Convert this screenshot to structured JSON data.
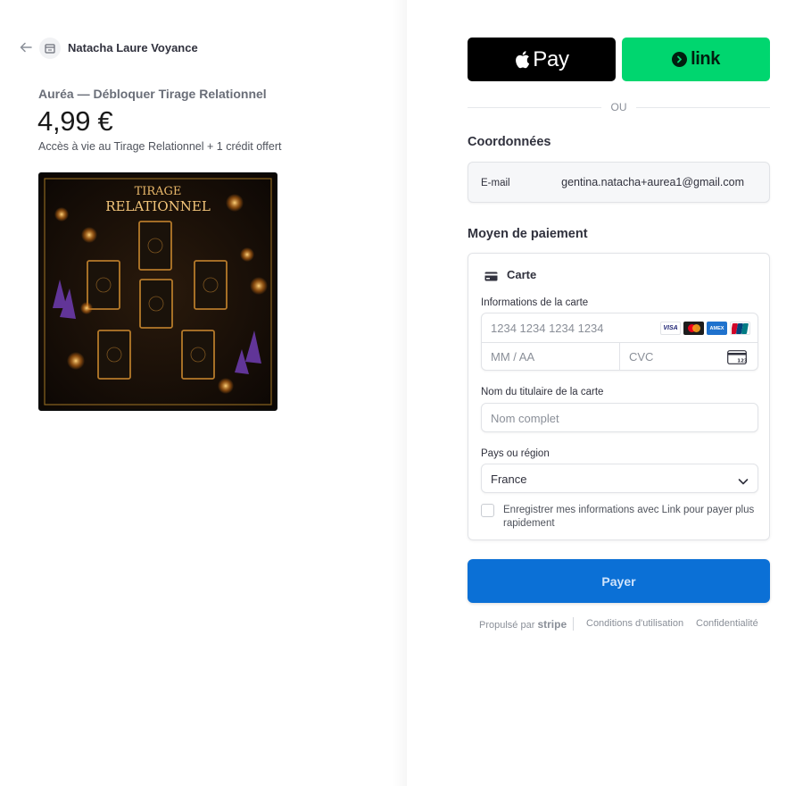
{
  "header": {
    "merchant_name": "Natacha Laure Voyance",
    "back_icon": "arrow-left-icon",
    "store_icon": "store-icon"
  },
  "product": {
    "name": "Auréa — Débloquer Tirage Relationnel",
    "price": "4,99 €",
    "description": "Accès à vie au Tirage Relationnel + 1 crédit offert",
    "image_title_line1": "TIRAGE",
    "image_title_line2": "RELATIONNEL"
  },
  "wallets": {
    "apple_pay_label": "Pay",
    "link_label": "link",
    "or_text": "OU"
  },
  "contact": {
    "title": "Coordonnées",
    "email_label": "E-mail",
    "email_value": "gentina.natacha+aurea1@gmail.com"
  },
  "payment": {
    "title": "Moyen de paiement",
    "tab_label": "Carte",
    "card_info_label": "Informations de la carte",
    "card_number_placeholder": "1234 1234 1234 1234",
    "expiry_placeholder": "MM / AA",
    "cvc_placeholder": "CVC",
    "cvc_icon_text": "123",
    "brands": [
      "VISA",
      "mastercard",
      "AMEX",
      "UnionPay"
    ],
    "cardholder_label": "Nom du titulaire de la carte",
    "cardholder_placeholder": "Nom complet",
    "country_label": "Pays ou région",
    "country_value": "France",
    "save_info_label": "Enregistrer mes informations avec Link pour payer plus rapidement",
    "save_info_checked": false
  },
  "actions": {
    "pay_label": "Payer"
  },
  "footer": {
    "powered_by": "Propulsé par",
    "stripe": "stripe",
    "terms": "Conditions d'utilisation",
    "privacy": "Confidentialité"
  },
  "colors": {
    "pay_button": "#0b70d6",
    "link_green": "#00d66f",
    "apple_black": "#000000"
  }
}
